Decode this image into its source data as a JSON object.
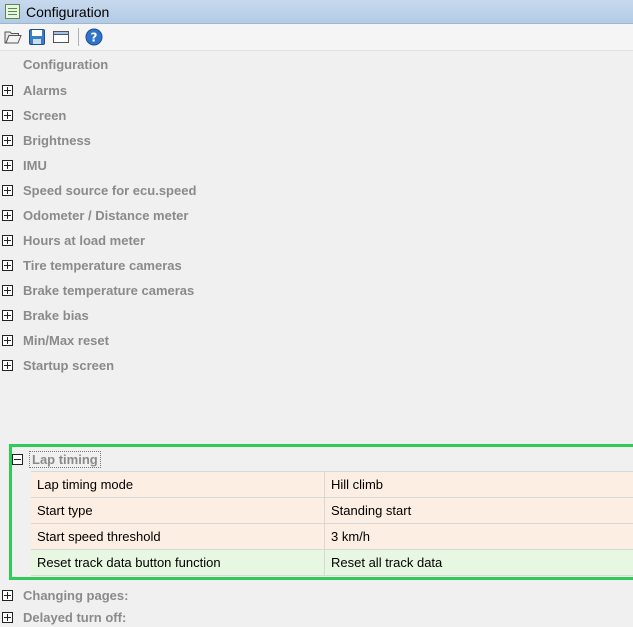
{
  "window": {
    "title": "Configuration",
    "icon": "list-window-icon"
  },
  "toolbar": {
    "buttons": [
      {
        "name": "open-folder-icon"
      },
      {
        "name": "save-disk-icon"
      },
      {
        "name": "window-icon"
      },
      {
        "name": "help-icon"
      }
    ]
  },
  "tree": {
    "root_label": "Configuration",
    "categories": [
      "Alarms",
      "Screen",
      "Brightness",
      "IMU",
      "Speed source for ecu.speed",
      "Odometer / Distance meter",
      "Hours at load meter",
      "Tire temperature cameras",
      "Brake temperature cameras",
      "Brake bias",
      "Min/Max reset",
      "Startup screen"
    ],
    "expanded_section": {
      "label": "Lap timing",
      "properties": [
        {
          "name": "Lap timing mode",
          "value": "Hill climb"
        },
        {
          "name": "Start type",
          "value": "Standing start"
        },
        {
          "name": "Start speed threshold",
          "value": "3 km/h"
        },
        {
          "name": "Reset track data button function",
          "value": "Reset all track data"
        }
      ]
    },
    "after_categories": [
      "Changing pages:",
      "Delayed turn off:"
    ]
  },
  "colors": {
    "highlight_border": "#2ecc55",
    "property_bg": "#fdeee3",
    "selected_property_bg": "#e8f7e2",
    "category_text": "#8a8a8a"
  }
}
